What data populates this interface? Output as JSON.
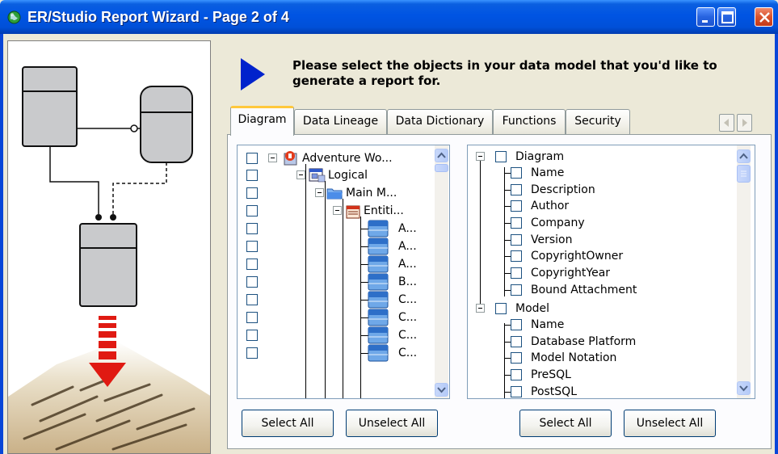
{
  "window": {
    "title": "ER/Studio Report Wizard - Page 2 of 4"
  },
  "header": {
    "instruction": "Please select the objects in your data model that you'd like to generate a report for."
  },
  "tabs": [
    {
      "label": "Diagram",
      "active": true
    },
    {
      "label": "Data Lineage",
      "active": false
    },
    {
      "label": "Data Dictionary",
      "active": false
    },
    {
      "label": "Functions",
      "active": false
    },
    {
      "label": "Security",
      "active": false
    }
  ],
  "left_tree": {
    "items": [
      {
        "label": "Adventure Wo...",
        "icon": "project-icon",
        "checked": false
      },
      {
        "label": "Logical",
        "icon": "model-icon",
        "checked": false
      },
      {
        "label": "Main M...",
        "icon": "folder-icon",
        "checked": false
      },
      {
        "label": "Entiti...",
        "icon": "entities-icon",
        "checked": false
      },
      {
        "label": "A...",
        "icon": "entity-icon",
        "checked": false
      },
      {
        "label": "A...",
        "icon": "entity-icon",
        "checked": false
      },
      {
        "label": "A...",
        "icon": "entity-icon",
        "checked": false
      },
      {
        "label": "B...",
        "icon": "entity-icon",
        "checked": false
      },
      {
        "label": "C...",
        "icon": "entity-icon",
        "checked": false
      },
      {
        "label": "C...",
        "icon": "entity-icon",
        "checked": false
      },
      {
        "label": "C...",
        "icon": "entity-icon",
        "checked": false
      },
      {
        "label": "C...",
        "icon": "entity-icon",
        "checked": false
      }
    ],
    "select_all_label": "Select All",
    "unselect_all_label": "Unselect All"
  },
  "right_tree": {
    "items": [
      {
        "label": "Diagram",
        "level": 0,
        "checked": false
      },
      {
        "label": "Name",
        "level": 1,
        "checked": false
      },
      {
        "label": "Description",
        "level": 1,
        "checked": false
      },
      {
        "label": "Author",
        "level": 1,
        "checked": false
      },
      {
        "label": "Company",
        "level": 1,
        "checked": false
      },
      {
        "label": "Version",
        "level": 1,
        "checked": false
      },
      {
        "label": "CopyrightOwner",
        "level": 1,
        "checked": false
      },
      {
        "label": "CopyrightYear",
        "level": 1,
        "checked": false
      },
      {
        "label": "Bound Attachment",
        "level": 1,
        "checked": false
      },
      {
        "label": "Model",
        "level": 0,
        "checked": false
      },
      {
        "label": "Name",
        "level": 1,
        "checked": false
      },
      {
        "label": "Database Platform",
        "level": 1,
        "checked": false
      },
      {
        "label": "Model Notation",
        "level": 1,
        "checked": false
      },
      {
        "label": "PreSQL",
        "level": 1,
        "checked": false
      },
      {
        "label": "PostSQL",
        "level": 1,
        "checked": false
      }
    ],
    "select_all_label": "Select All",
    "unselect_all_label": "Unselect All"
  },
  "colors": {
    "titlebar": "#0054E3",
    "dialog_bg": "#ECE9D8",
    "arrow": "#0022CC",
    "active_tab_highlight": "#FFC83C"
  }
}
